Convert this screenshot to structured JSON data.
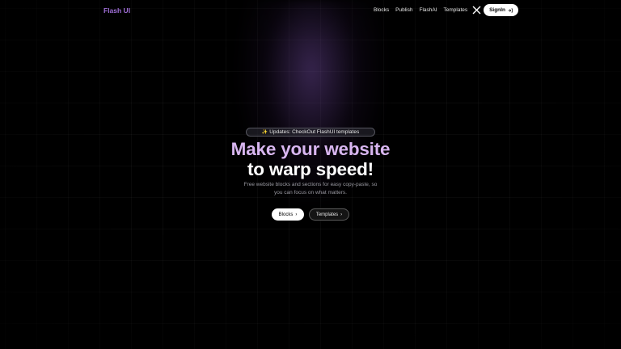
{
  "header": {
    "logo": "Flash UI",
    "nav": [
      {
        "label": "Blocks"
      },
      {
        "label": "Publish"
      },
      {
        "label": "FlashAI"
      },
      {
        "label": "Templates"
      }
    ],
    "social_icon": "x-logo-icon",
    "signin_label": "SignIn",
    "signin_icon": "login-arrow-icon"
  },
  "hero": {
    "badge_icon": "sparkle-icon",
    "badge_text": "Updates: CheckOut FlashUI templates",
    "headline_line1": "Make your website",
    "headline_line2": "to warp speed!",
    "subtitle": "Free website blocks and sections for easy copy-paste, so you can focus on what matters.",
    "primary_button": "Blocks",
    "secondary_button": "Templates",
    "button_chevron": "›"
  },
  "colors": {
    "background": "#000000",
    "brand": "#a06fd8",
    "headline_accent": "#d8b6f0"
  }
}
